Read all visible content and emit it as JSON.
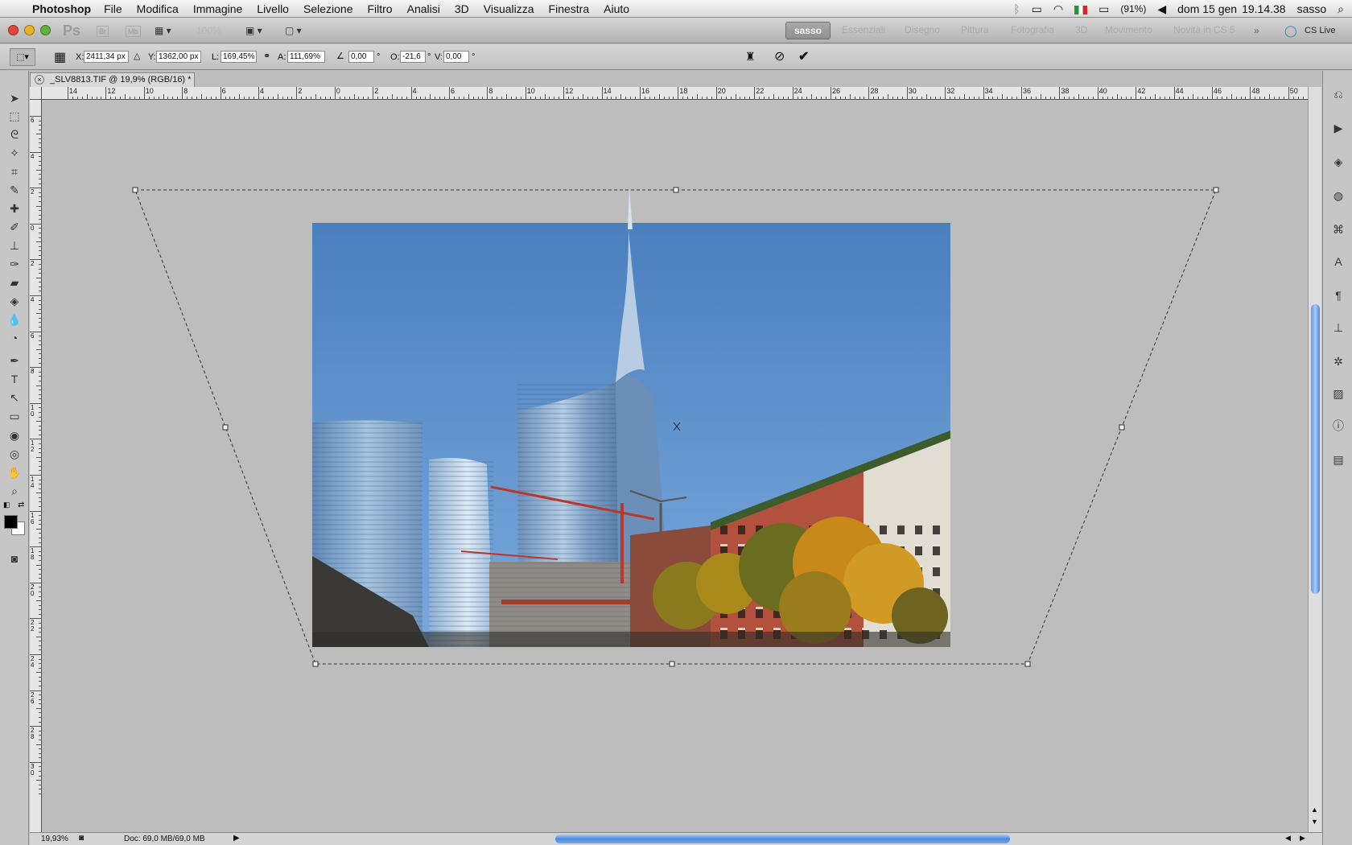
{
  "menubar": {
    "app_name": "Photoshop",
    "menus": [
      "File",
      "Modifica",
      "Immagine",
      "Livello",
      "Selezione",
      "Filtro",
      "Analisi",
      "3D",
      "Visualizza",
      "Finestra",
      "Aiuto"
    ],
    "battery": "(91%)",
    "date": "dom 15 gen",
    "time": "19.14.38",
    "user": "sasso"
  },
  "appbar": {
    "ps_logo": "Ps",
    "br_label": "Br",
    "mb_label": "Mb",
    "zoom": "100%",
    "active_workspace": "sasso",
    "workspaces": [
      "Essenziali",
      "Disegno",
      "Pittura",
      "Fotografia",
      "3D",
      "Movimento",
      "Novità in CS 5"
    ],
    "cs_live": "CS Live"
  },
  "options": {
    "x_label": "X:",
    "x_value": "2411,34 px",
    "y_label": "Y:",
    "y_value": "1362,00 px",
    "w_label": "L:",
    "w_value": "169,45%",
    "h_label": "A:",
    "h_value": "111,69%",
    "angle_value": "0,00",
    "deg": "°",
    "hskew_label": "O:",
    "hskew_value": "-21,6",
    "vskew_label": "V:",
    "vskew_value": "0,00"
  },
  "document": {
    "tab_title": "_SLV8813.TIF @ 19,9% (RGB/16) *"
  },
  "rulers": {
    "top_labels": [
      "14",
      "12",
      "10",
      "8",
      "6",
      "4",
      "2",
      "0",
      "2",
      "4",
      "6",
      "8",
      "10",
      "12",
      "14",
      "16",
      "18",
      "20",
      "22",
      "24",
      "26",
      "28",
      "30",
      "32",
      "34",
      "36",
      "38",
      "40",
      "42",
      "44",
      "46",
      "48",
      "50"
    ],
    "left_labels": [
      "6",
      "4",
      "2",
      "0",
      "2",
      "4",
      "6",
      "8",
      "1 0",
      "1 2",
      "1 4",
      "1 6",
      "1 8",
      "2 0",
      "2 2",
      "2 4",
      "2 6",
      "2 8",
      "3 0"
    ]
  },
  "status": {
    "zoom": "19,93%",
    "doc": "Doc: 69,0 MB/69,0 MB"
  },
  "colors": {
    "canvas_bg": "#bdbdbd",
    "sky": "#4f85c3",
    "scroll_accent": "#4b8be0"
  }
}
